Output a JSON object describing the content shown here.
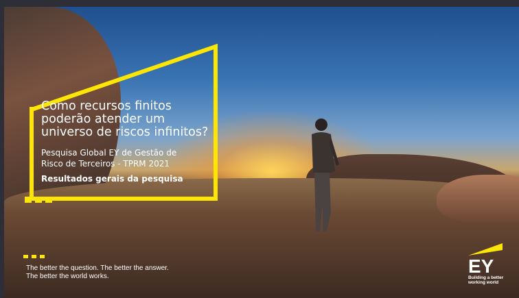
{
  "slide": {
    "headline": [
      "Como recursos finitos",
      "poderão atender um",
      "universo de riscos infinitos?"
    ],
    "subtitle": [
      "Pesquisa Global EY de Gestão de",
      "Risco de Terceiros - TPRM 2021"
    ],
    "results": "Resultados gerais da pesquisa"
  },
  "footer": {
    "tagline_line1": "The better the question. The better the answer.",
    "tagline_line2": "The better the world works."
  },
  "logo": {
    "wordmark": "EY",
    "slogan_line1": "Building a better",
    "slogan_line2": "working world"
  },
  "colors": {
    "accent": "#ffe600",
    "text": "#ffffff",
    "background": "#2e2e38"
  }
}
